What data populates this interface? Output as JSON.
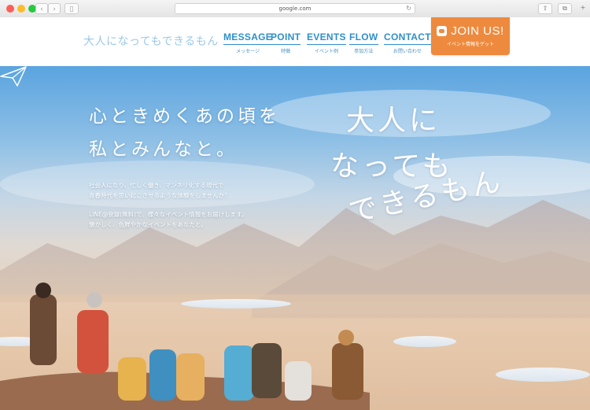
{
  "browser": {
    "url": "google.com"
  },
  "header": {
    "logo": "大人になってもできるもん",
    "nav": [
      {
        "en": "MESSAGE",
        "jp": "メッセージ"
      },
      {
        "en": "POINT",
        "jp": "特徴"
      },
      {
        "en": "EVENTS",
        "jp": "イベント例"
      },
      {
        "en": "FLOW",
        "jp": "参加方法"
      },
      {
        "en": "CONTACT",
        "jp": "お問い合わせ"
      }
    ],
    "join": {
      "label": "JOIN US!",
      "sub": "イベント情報をゲット"
    }
  },
  "hero": {
    "catch": [
      "心ときめくあの頃を",
      "私とみんなと。"
    ],
    "desc1": [
      "社会人になり、忙しく働き、マンネリ化する現代で",
      "青春時代を思い起こさせるような体験をしませんか？"
    ],
    "desc2": [
      "LINE@登録(無料)で、様々なイベント情報をお届けします。",
      "懐かしく、色鮮やかなイベントをあなたと。"
    ],
    "title": [
      "大人に",
      "なっても",
      "できるもん"
    ]
  },
  "colors": {
    "accent": "#2f8fc9",
    "join": "#ee8a3e",
    "logo": "#9cc9e6"
  }
}
